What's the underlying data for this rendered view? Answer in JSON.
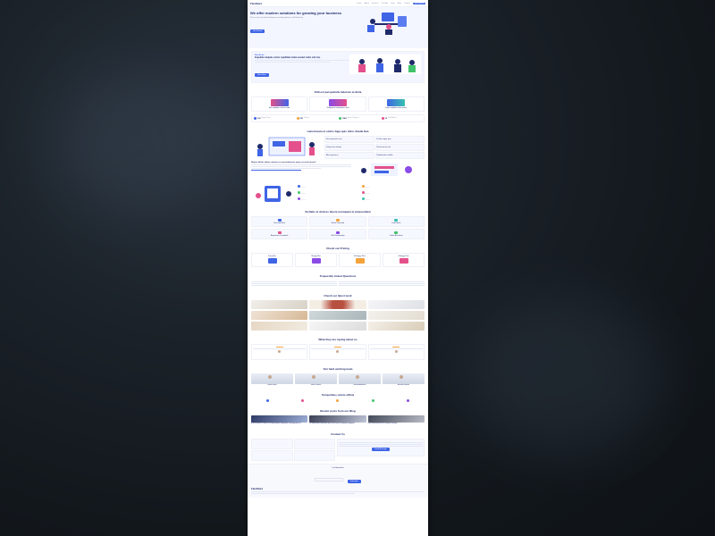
{
  "brand": "FlexStart",
  "nav": {
    "items": [
      "Home",
      "About",
      "Services",
      "Portfolio",
      "Team",
      "Blog",
      "Contact"
    ],
    "cta": "Get Started"
  },
  "hero": {
    "title": "We offer modern solutions for growing your business",
    "subtitle": "We are team of talented designers making websites with Bootstrap",
    "button": "Get Started"
  },
  "about": {
    "eyebrow": "Who We Are",
    "title": "Expedita voluptas omnis cupiditate totam eveniet nobis sint iste.",
    "button": "Read More"
  },
  "values": {
    "title": "Odit est perspiciatis laborum et dicta",
    "items": [
      {
        "label": "Ad cupiditate sed est odio"
      },
      {
        "label": "Voluptatem voluptatum alias"
      },
      {
        "label": "Fugit cupiditate alias nobis."
      }
    ]
  },
  "counts": [
    {
      "value": "232",
      "label": "Happy Clients"
    },
    {
      "value": "521",
      "label": "Projects"
    },
    {
      "value": "1463",
      "label": "Hours Of Support"
    },
    {
      "value": "15",
      "label": "Hard Workers"
    }
  ],
  "features": {
    "title": "Laboriosam et omnis fuga quis dolor direda fara",
    "items": [
      "Eos aspernatur rem",
      "Facilis neque ipsa",
      "Volup amet volupta",
      "Rerum omnis sint",
      "Alias possimus",
      "Repellendus mollitia"
    ],
    "sub_title": "Neque officiis dolore maiores et exercitationem quae est sunt harum?"
  },
  "services": {
    "title": "Veritatis et dolores facere numquam et praesentium",
    "items": [
      {
        "name": "Nesciunt Mete"
      },
      {
        "name": "Eosle Commodi"
      },
      {
        "name": "Ledo Markt"
      },
      {
        "name": "Asperiores Commodit"
      },
      {
        "name": "Velit Doloremque"
      },
      {
        "name": "Dolori Architecto"
      }
    ]
  },
  "pricing": {
    "title": "Check our Pricing",
    "plans": [
      {
        "name": "Free Plan",
        "price": "$0"
      },
      {
        "name": "Starter Plan",
        "price": "$19"
      },
      {
        "name": "Business Plan",
        "price": "$29"
      },
      {
        "name": "Ultimate Plan",
        "price": "$49"
      }
    ]
  },
  "faq": {
    "title": "Frequently Asked Questions"
  },
  "portfolio": {
    "title": "Check our latest work"
  },
  "testimonials": {
    "title": "What they are saying about us"
  },
  "team": {
    "title": "Our hard working team",
    "members": [
      {
        "name": "Walter White"
      },
      {
        "name": "Sarah Jhinson"
      },
      {
        "name": "William Anderson"
      },
      {
        "name": "Amanda Jepson"
      }
    ]
  },
  "clients": {
    "title": "Temporibus omnis officia"
  },
  "blog": {
    "title": "Recent posts from our Blog",
    "posts": [
      {
        "title": "Eum ad dolor et. Autem aut fugiat debitis voluptatem consequuntur sit"
      },
      {
        "title": "Et repellendus molestiae qui est sed omnis voluptates magnam"
      },
      {
        "title": "Quia assumenda est et veritatis aut quae"
      }
    ]
  },
  "contact": {
    "title": "Contact Us",
    "button": "Send Message"
  },
  "newsletter": {
    "title": "Our Newsletter",
    "button": "Subscribe"
  },
  "footer": {
    "brand": "FlexStart"
  }
}
